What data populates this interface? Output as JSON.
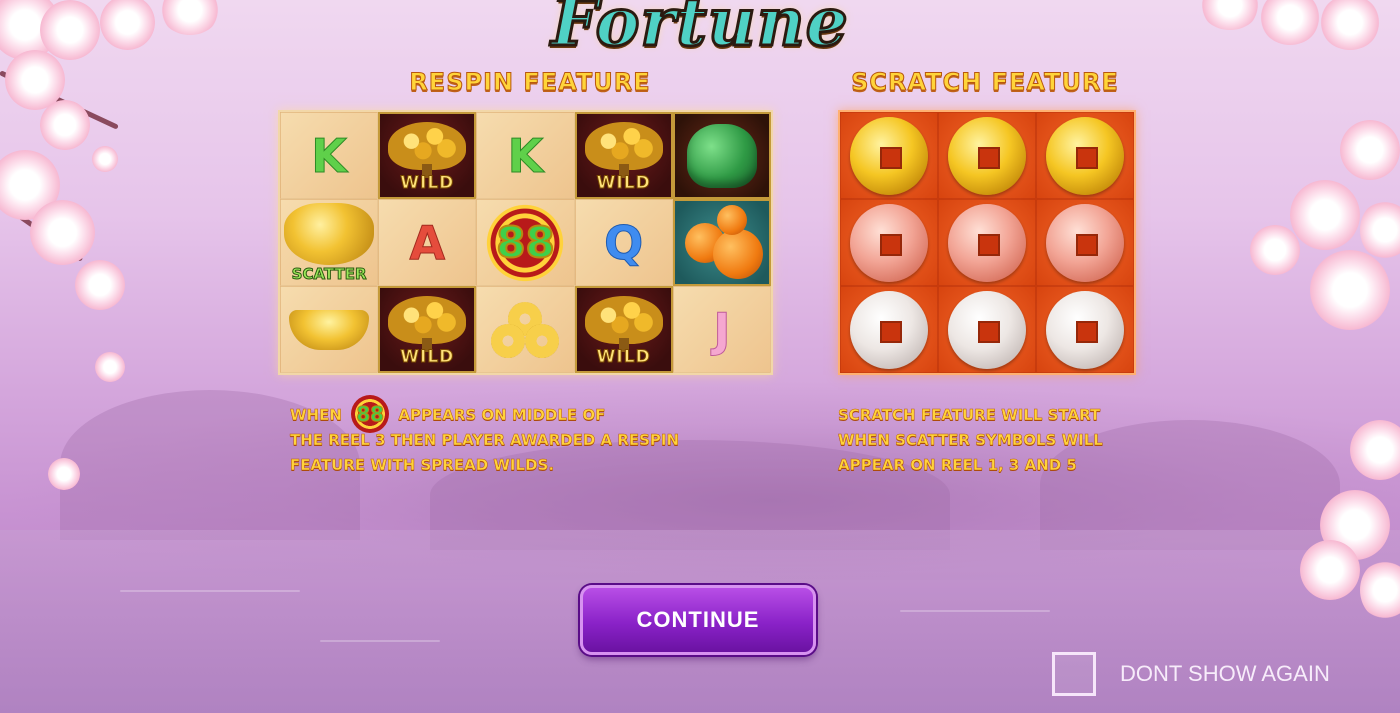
{
  "logo": {
    "text": "Fortune"
  },
  "respin": {
    "title": "RESPIN FEATURE",
    "reels": [
      [
        "K",
        "WILD",
        "K",
        "WILD",
        "jade-lion"
      ],
      [
        "SCATTER",
        "A",
        "88",
        "Q",
        "oranges"
      ],
      [
        "gold-ingot",
        "WILD",
        "coin-knot",
        "WILD",
        "J"
      ]
    ],
    "description_part1": "WHEN",
    "description_icon": "88",
    "description_part2": "APPEARS ON MIDDLE OF",
    "description_line2": "THE REEL 3 THEN PLAYER AWARDED A RESPIN",
    "description_line3": "FEATURE WITH SPREAD WILDS."
  },
  "scratch": {
    "title": "SCRATCH FEATURE",
    "coin_rows": [
      "gold",
      "rose",
      "silver"
    ],
    "description_line1": "SCRATCH FEATURE WILL START",
    "description_line2": "WHEN SCATTER SYMBOLS WILL",
    "description_line3": "APPEAR ON REEL 1, 3 AND 5"
  },
  "controls": {
    "continue_label": "CONTINUE",
    "dont_show_label": "DONT SHOW AGAIN"
  },
  "colors": {
    "title_gold": "#ffd43a",
    "button_purple": "#8a22c8",
    "scratch_red": "#e5521e"
  }
}
